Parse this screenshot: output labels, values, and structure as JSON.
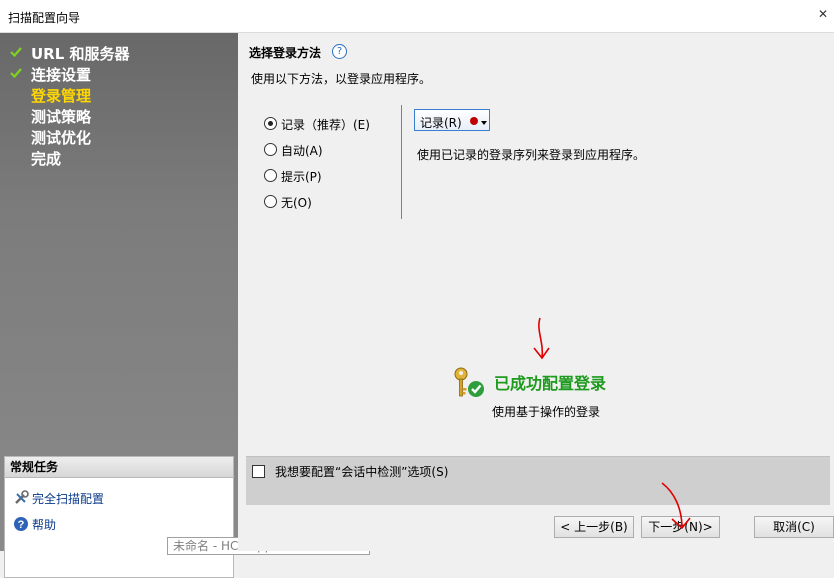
{
  "window": {
    "title": "扫描配置向导"
  },
  "sidebar": {
    "nav": [
      {
        "label": "URL 和服务器",
        "done": true,
        "active": false
      },
      {
        "label": "连接设置",
        "done": true,
        "active": false
      },
      {
        "label": "登录管理",
        "done": false,
        "active": true
      },
      {
        "label": "测试策略",
        "done": false,
        "active": false
      },
      {
        "label": "测试优化",
        "done": false,
        "active": false
      },
      {
        "label": "完成",
        "done": false,
        "active": false
      }
    ],
    "tasks": {
      "header": "常规任务",
      "items": [
        {
          "label": "完全扫描配置",
          "icon": "wrench-icon"
        },
        {
          "label": "帮助",
          "icon": "help-icon"
        }
      ]
    },
    "tooltip": "未命名 - HCL AppScan Standard"
  },
  "main": {
    "section_title": "选择登录方法",
    "subtitle": "使用以下方法，以登录应用程序。",
    "login_methods": [
      {
        "label": "记录（推荐）(E)",
        "checked": true
      },
      {
        "label": "自动(A)",
        "checked": false
      },
      {
        "label": "提示(P)",
        "checked": false
      },
      {
        "label": "无(O)",
        "checked": false
      }
    ],
    "record_button": {
      "label": "记录(R)"
    },
    "record_description": "使用已记录的登录序列来登录到应用程序。",
    "success": {
      "title": "已成功配置登录",
      "description": "使用基于操作的登录"
    },
    "option": {
      "label": "我想要配置“会话中检测”选项(S)",
      "checked": false
    }
  },
  "buttons": {
    "back": "< 上一步(B)",
    "next": "下一步(N)>",
    "cancel": "取消(C)"
  },
  "colors": {
    "accent": "#ffd700",
    "success": "#1e9a1e",
    "record_dot": "#c00000",
    "annotation": "#e00000"
  }
}
